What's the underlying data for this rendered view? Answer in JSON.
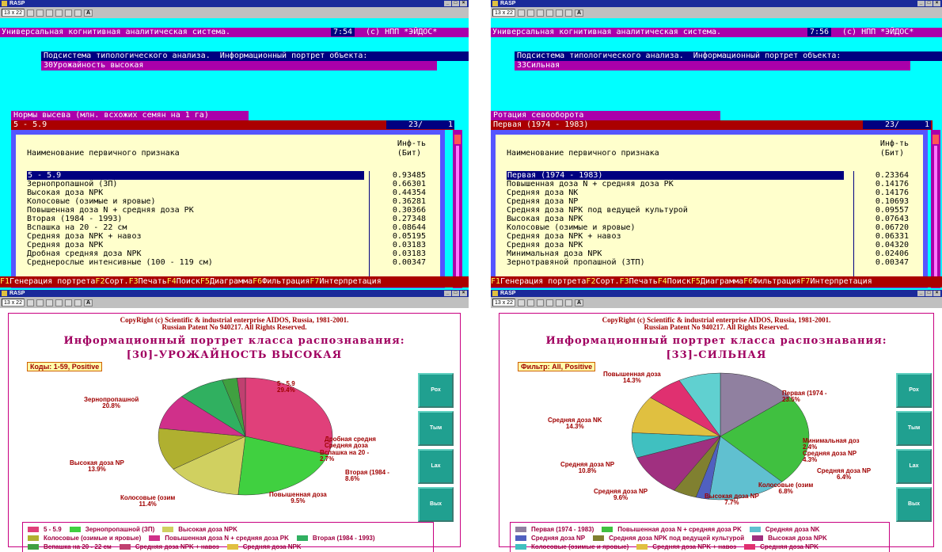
{
  "title_bar": "RASP",
  "toolbar": {
    "font_select": "13 x 22",
    "a_button": "A"
  },
  "left_text": {
    "header": "Универсальная когнитивная аналитическая система.",
    "time": "7:54",
    "copyright": "(с) НПП *ЭЙДОС*",
    "subsystem": "Подсистема типологического анализа.",
    "portrait": "Информационный портрет объекта:",
    "object": "30Урожайность высокая",
    "section": "Нормы высева (млн. всхожих семян на 1 га)",
    "selected": "5 - 5.9",
    "count": "23/",
    "count_right": "1",
    "col_name": "Наименование первичного признака",
    "col_info1": "Инф-ть",
    "col_info2": "(Бит)",
    "rows": [
      {
        "name": "5 - 5.9",
        "value": "0.93485"
      },
      {
        "name": "Зернопропашной (ЗП)",
        "value": "0.66301"
      },
      {
        "name": "Высокая доза NPK",
        "value": "0.44354"
      },
      {
        "name": "Колосовые (озимые и яровые)",
        "value": "0.36281"
      },
      {
        "name": "Повышенная доза N + средняя доза PK",
        "value": "0.30366"
      },
      {
        "name": "Вторая (1984 - 1993)",
        "value": "0.27348"
      },
      {
        "name": "Вспашка на 20 - 22 см",
        "value": "0.08644"
      },
      {
        "name": "Средняя доза NPK + навоз",
        "value": "0.05195"
      },
      {
        "name": "Средняя доза NPK",
        "value": "0.03183"
      },
      {
        "name": "Дробная средняя доза NPK",
        "value": "0.03183"
      },
      {
        "name": "Среднерослые интенсивные (100 - 119 см)",
        "value": "0.00347"
      }
    ]
  },
  "right_text": {
    "header": "Универсальная когнитивная аналитическая система.",
    "time": "7:56",
    "copyright": "(с) НПП *ЭЙДОС*",
    "subsystem": "Подсистема типологического анализа.",
    "portrait": "Информационный портрет объекта:",
    "object": "33Сильная",
    "section": "Ротация севооборота",
    "selected": "Первая (1974 - 1983)",
    "count": "23/",
    "count_right": "1",
    "col_name": "Наименование первичного признака",
    "col_info1": "Инф-ть",
    "col_info2": "(Бит)",
    "rows": [
      {
        "name": "Первая (1974 - 1983)",
        "value": "0.23364"
      },
      {
        "name": "Повышенная доза N + средняя доза PK",
        "value": "0.14176"
      },
      {
        "name": "Средняя доза NK",
        "value": "0.14176"
      },
      {
        "name": "Средняя доза NP",
        "value": "0.10693"
      },
      {
        "name": "Средняя доза NPK под ведущей культурой",
        "value": "0.09557"
      },
      {
        "name": "Высокая доза NPK",
        "value": "0.07643"
      },
      {
        "name": "Колосовые (озимые и яровые)",
        "value": "0.06720"
      },
      {
        "name": "Средняя доза NPK + навоз",
        "value": "0.06331"
      },
      {
        "name": "Средняя доза NPK",
        "value": "0.04320"
      },
      {
        "name": "Минимальная доза NPK",
        "value": "0.02406"
      },
      {
        "name": "Зернотравяной пропашной (ЗТП)",
        "value": "0.00347"
      }
    ]
  },
  "fkeys": [
    {
      "k": "F1",
      "l": "Генерация портрета"
    },
    {
      "k": "F2",
      "l": "Сорт."
    },
    {
      "k": "F3",
      "l": "Печать"
    },
    {
      "k": "F4",
      "l": "Поиск"
    },
    {
      "k": "F5",
      "l": "Диаграмма"
    },
    {
      "k": "F6",
      "l": "Фильтрация"
    },
    {
      "k": "F7",
      "l": "Интерпретация"
    }
  ],
  "left_graph": {
    "copyright1": "CopyRight (c) Scientific & industrial enterprise AIDOS, Russia, 1981-2001.",
    "copyright2": "Russian Patent No 940217. All Rights Reserved.",
    "heading": "Информационный портрет класса распознавания:",
    "class_name": "[30]-УРОЖАЙНОСТЬ ВЫСОКАЯ",
    "tag": "Коды: 1-59, Positive",
    "buttons": [
      "Рох",
      "Тым",
      "Lax",
      "Вых"
    ],
    "slice_labels": [
      {
        "t1": "5 - 5.9",
        "t2": "29.4%"
      },
      {
        "t1": "Зернопропашной",
        "t2": "20.8%"
      },
      {
        "t1": "Высокая доза NP",
        "t2": "13.9%"
      },
      {
        "t1": "Колосовые (озим",
        "t2": "11.4%"
      },
      {
        "t1": "Повышенная доза",
        "t2": "9.5%"
      },
      {
        "t1": "Вторая (1984 -",
        "t2": "8.6%"
      },
      {
        "t1": "Вспашка на 20 -",
        "t2": "2.7%"
      },
      {
        "t1": "Дробная средня",
        "t2": "Средняя доза"
      }
    ],
    "legend": [
      {
        "label": "5 - 5.9",
        "color": "#e0407a"
      },
      {
        "label": "Зернопропашной (ЗП)",
        "color": "#40d040"
      },
      {
        "label": "Высокая доза NPK",
        "color": "#d0d060"
      },
      {
        "label": "Колосовые (озимые и яровые)",
        "color": "#b0b030"
      },
      {
        "label": "Повышенная доза N + средняя доза PK",
        "color": "#d0308a"
      },
      {
        "label": "Вторая (1984 - 1993)",
        "color": "#30b060"
      },
      {
        "label": "Вспашка на 20 - 22 см",
        "color": "#40a040"
      },
      {
        "label": "Средняя доза NPK + навоз",
        "color": "#c04070"
      },
      {
        "label": "Средняя доза NPK",
        "color": "#e0c040"
      },
      {
        "label": "Дробная средняя доза NPK",
        "color": "#40a060"
      }
    ]
  },
  "right_graph": {
    "copyright1": "CopyRight (c) Scientific & industrial enterprise AIDOS, Russia, 1981-2001.",
    "copyright2": "Russian Patent No 940217. All Rights Reserved.",
    "heading": "Информационный портрет класса распознавания:",
    "class_name": "[33]-СИЛЬНАЯ",
    "tag": "Фильтр: All, Positive",
    "buttons": [
      "Рох",
      "Тым",
      "Lax",
      "Вых"
    ],
    "slice_labels": [
      {
        "t1": "Повышенная доза",
        "t2": "14.3%"
      },
      {
        "t1": "Первая (1974 -",
        "t2": "23.5%"
      },
      {
        "t1": "Средняя доза NK",
        "t2": "14.3%"
      },
      {
        "t1": "Минимальная доз",
        "t2": "2.4%"
      },
      {
        "t1": "Средняя доза NP",
        "t2": "4.3%"
      },
      {
        "t1": "Средняя доза NP",
        "t2": "10.8%"
      },
      {
        "t1": "Средняя доза NP",
        "t2": "6.4%"
      },
      {
        "t1": "Средняя доза NP",
        "t2": "9.6%"
      },
      {
        "t1": "Колосовые (озим",
        "t2": "6.8%"
      },
      {
        "t1": "Высокая доза NP",
        "t2": "7.7%"
      }
    ],
    "legend": [
      {
        "label": "Первая (1974 - 1983)",
        "color": "#9080a0"
      },
      {
        "label": "Повышенная доза N + средняя доза PK",
        "color": "#40c040"
      },
      {
        "label": "Средняя доза NK",
        "color": "#60c0d0"
      },
      {
        "label": "Средняя доза NP",
        "color": "#5060c0"
      },
      {
        "label": "Средняя доза NPK под ведущей культурой",
        "color": "#808030"
      },
      {
        "label": "Высокая доза NPK",
        "color": "#a03080"
      },
      {
        "label": "Колосовые (озимые и яровые)",
        "color": "#40c0c0"
      },
      {
        "label": "Средняя доза NPK + навоз",
        "color": "#e0c040"
      },
      {
        "label": "Средняя доза NPK",
        "color": "#e03070"
      },
      {
        "label": "Минимальная доза NPK",
        "color": "#60d0d0"
      }
    ]
  }
}
